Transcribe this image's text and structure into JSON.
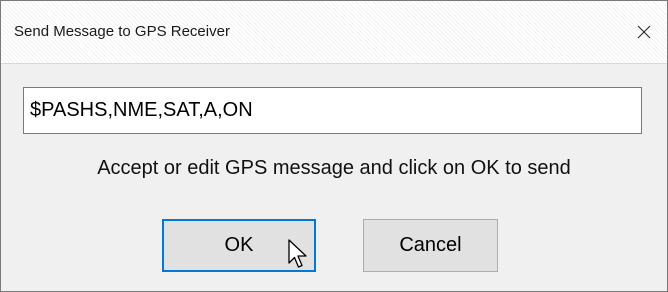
{
  "window": {
    "title": "Send Message to GPS Receiver",
    "close_glyph": "✕"
  },
  "message": {
    "value": "$PASHS,NME,SAT,A,ON"
  },
  "instruction": "Accept or edit GPS message and click on OK to send",
  "buttons": {
    "ok_label": "OK",
    "cancel_label": "Cancel"
  },
  "colors": {
    "focus_border": "#0078d7",
    "dialog_bg": "#f0f0f0",
    "button_bg": "#e1e1e1"
  },
  "icons": {
    "close": "close-icon",
    "pointer": "mouse-pointer-icon"
  }
}
